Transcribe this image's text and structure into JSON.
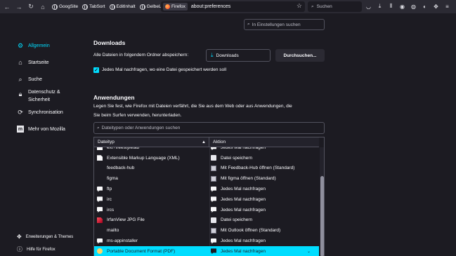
{
  "toolbar": {
    "bookmarks": [
      "GoogSite",
      "TabSort",
      "EditInhalt",
      "GelbeLinks"
    ],
    "url_chip": "Firefox",
    "url": "about:preferences",
    "search_placeholder": "Suchen"
  },
  "sidebar": {
    "categories": [
      {
        "label": "Allgemein",
        "icon": "gear-icon",
        "active": true
      },
      {
        "label": "Startseite",
        "icon": "home-icon"
      },
      {
        "label": "Suche",
        "icon": "search-icon"
      },
      {
        "label": "Datenschutz & Sicherheit",
        "icon": "lock-icon"
      },
      {
        "label": "Synchronisation",
        "icon": "sync-icon"
      },
      {
        "label": "Mehr von Mozilla",
        "icon": "mozilla-icon"
      }
    ],
    "footer": [
      {
        "label": "Erweiterungen & Themes",
        "icon": "puzzle-icon"
      },
      {
        "label": "Hilfe für Firefox",
        "icon": "help-icon"
      }
    ]
  },
  "find_placeholder": "In Einstellungen suchen",
  "downloads": {
    "heading": "Downloads",
    "save_label": "Alle Dateien in folgendem Ordner abspeichern:",
    "folder": "Downloads",
    "browse_button": "Durchsuchen...",
    "ask_label": "Jedes Mal nachfragen, wo eine Datei gespeichert werden soll",
    "ask_checked": true
  },
  "applications": {
    "heading": "Anwendungen",
    "description_line1": "Legen Sie fest, wie Firefox mit Dateien verfährt, die Sie aus dem Web oder aus Anwendungen, die",
    "description_line2": "Sie beim Surfen verwenden, herunterladen.",
    "filter_placeholder": "Dateitypen oder Anwendungen suchen",
    "col_type": "Dateityp",
    "col_action": "Aktion",
    "rows": [
      {
        "type": "ext+freestyletab",
        "type_icon": "doc",
        "action": "Jedes Mal nachfragen",
        "action_icon": "chat"
      },
      {
        "type": "Extensible Markup Language (XML)",
        "type_icon": "doc",
        "action": "Datei speichern",
        "action_icon": "save"
      },
      {
        "type": "feedback-hub",
        "type_icon": "none",
        "action": "Mit Feedback-Hub öffnen (Standard)",
        "action_icon": "app"
      },
      {
        "type": "figma",
        "type_icon": "none",
        "action": "Mit figma öffnen (Standard)",
        "action_icon": "app"
      },
      {
        "type": "ftp",
        "type_icon": "chat",
        "action": "Jedes Mal nachfragen",
        "action_icon": "chat"
      },
      {
        "type": "irc",
        "type_icon": "chat",
        "action": "Jedes Mal nachfragen",
        "action_icon": "chat"
      },
      {
        "type": "ircs",
        "type_icon": "chat",
        "action": "Jedes Mal nachfragen",
        "action_icon": "chat"
      },
      {
        "type": "IrfanView JPG File",
        "type_icon": "red",
        "action": "Datei speichern",
        "action_icon": "save"
      },
      {
        "type": "mailto",
        "type_icon": "none",
        "action": "Mit Outlook öffnen (Standard)",
        "action_icon": "app"
      },
      {
        "type": "ms-appinstaller",
        "type_icon": "chat",
        "action": "Jedes Mal nachfragen",
        "action_icon": "chat"
      },
      {
        "type": "Portable Document Format (PDF)",
        "type_icon": "pdf",
        "action": "Jedes Mal nachfragen",
        "action_icon": "chat",
        "selected": true
      }
    ]
  },
  "colors": {
    "accent": "#00ddff",
    "background": "#1c1b22",
    "toolbar": "#2b2a33"
  }
}
